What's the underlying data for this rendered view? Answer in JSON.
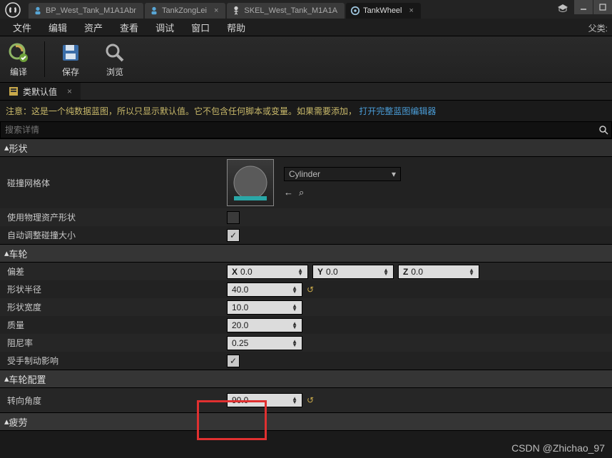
{
  "tabs": [
    {
      "label": "BP_West_Tank_M1A1Abr",
      "active": false
    },
    {
      "label": "TankZongLei",
      "active": false
    },
    {
      "label": "SKEL_West_Tank_M1A1A",
      "active": false
    },
    {
      "label": "TankWheel",
      "active": true
    }
  ],
  "parent_label": "父类:",
  "menu": {
    "file": "文件",
    "edit": "编辑",
    "asset": "资产",
    "view": "查看",
    "debug": "调试",
    "window": "窗口",
    "help": "帮助"
  },
  "toolbar": {
    "compile": "编译",
    "save": "保存",
    "browse": "浏览"
  },
  "subtab": {
    "label": "类默认值"
  },
  "notice": {
    "prefix": "注意：这是一个纯数据蓝图，所以只显示默认值。它不包含任何脚本或变量。如果需要添加，",
    "link": "打开完整蓝图编辑器"
  },
  "search": {
    "placeholder": "搜索详情"
  },
  "sections": {
    "shape": {
      "title": "形状",
      "collision_mesh": {
        "label": "碰撞网格体",
        "asset": "Cylinder"
      },
      "use_phys": {
        "label": "使用物理资产形状",
        "checked": false
      },
      "auto_adjust": {
        "label": "自动调整碰撞大小",
        "checked": true
      }
    },
    "wheel": {
      "title": "车轮",
      "offset": {
        "label": "偏差",
        "x": "0.0",
        "y": "0.0",
        "z": "0.0"
      },
      "radius": {
        "label": "形状半径",
        "value": "40.0"
      },
      "width": {
        "label": "形状宽度",
        "value": "10.0"
      },
      "mass": {
        "label": "质量",
        "value": "20.0"
      },
      "damping": {
        "label": "阻尼率",
        "value": "0.25"
      },
      "hb": {
        "label": "受手制动影响",
        "checked": true
      }
    },
    "steer": {
      "title": "车轮配置",
      "angle": {
        "label": "转向角度",
        "value": "90.0"
      }
    },
    "fatigue": {
      "title": "疲劳"
    }
  },
  "watermark": "CSDN @Zhichao_97"
}
